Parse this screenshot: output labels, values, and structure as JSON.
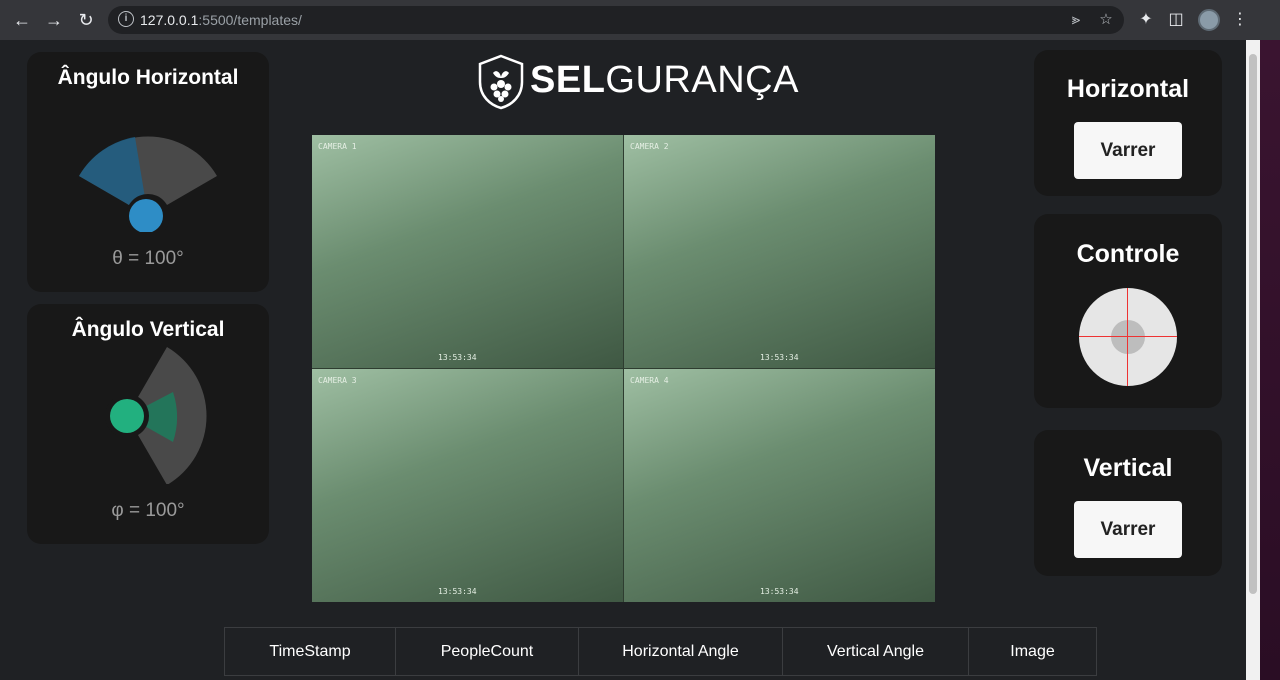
{
  "browser": {
    "url_host": "127.0.0.1",
    "url_rest": ":5500/templates/",
    "info_icon": "info-icon"
  },
  "logo": {
    "bold": "SEL",
    "rest": "GURANÇA"
  },
  "gauges": {
    "horizontal": {
      "title": "Ângulo Horizontal",
      "readout": "θ = 100°",
      "color": "#2e8dc6"
    },
    "vertical": {
      "title": "Ângulo Vertical",
      "readout": "φ = 100°",
      "color": "#22b07f"
    }
  },
  "video": {
    "cameras": [
      {
        "label": "CAMERA 1",
        "time": "13:53:34"
      },
      {
        "label": "CAMERA 2",
        "time": "13:53:34"
      },
      {
        "label": "CAMERA 3",
        "time": "13:53:34"
      },
      {
        "label": "CAMERA 4",
        "time": "13:53:34"
      }
    ]
  },
  "controls": {
    "horizontal": {
      "title": "Horizontal",
      "button": "Varrer"
    },
    "joystick": {
      "title": "Controle"
    },
    "vertical": {
      "title": "Vertical",
      "button": "Varrer"
    }
  },
  "table": {
    "headers": [
      "TimeStamp",
      "PeopleCount",
      "Horizontal Angle",
      "Vertical Angle",
      "Image"
    ]
  }
}
